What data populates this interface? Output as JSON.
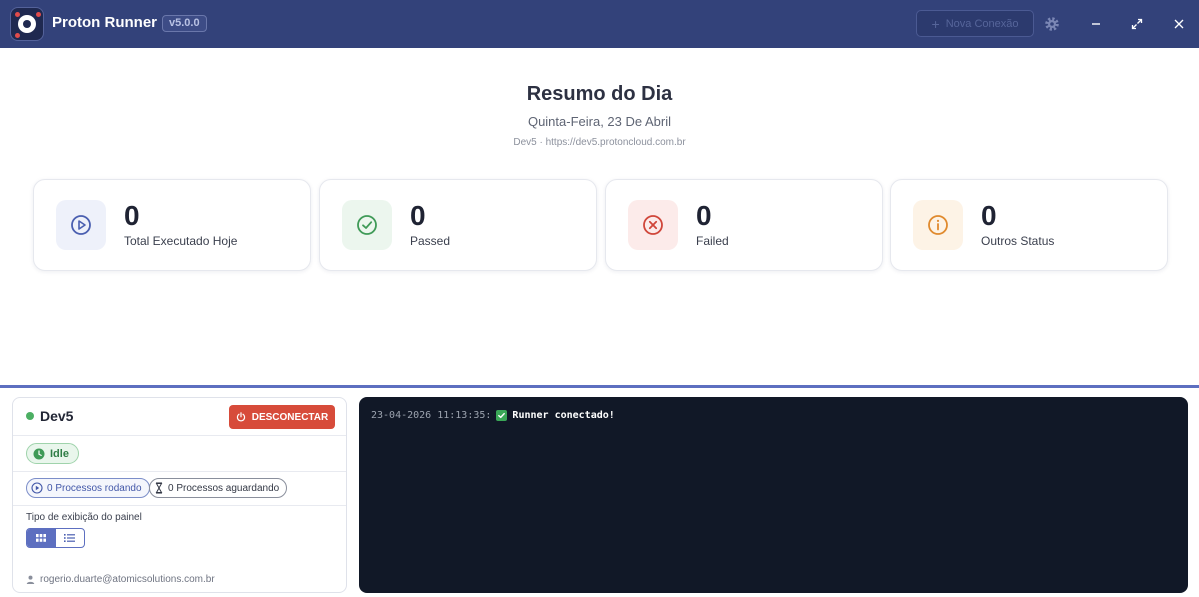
{
  "window": {
    "app_title": "Proton Runner",
    "version": "v5.0.0",
    "new_connection_label": "Nova Conexão",
    "icons": [
      "gear-icon",
      "minimize-icon",
      "maximize-icon",
      "close-icon"
    ]
  },
  "summary": {
    "title": "Resumo do Dia",
    "date": "Quinta-Feira, 23 De Abril",
    "environment": "Dev5 · https://dev5.protoncloud.com.br",
    "cards": [
      {
        "value": "0",
        "label": "Total Executado Hoje",
        "icon": "play-icon",
        "color": "#4a5fb0",
        "bg": "#eef1fa"
      },
      {
        "value": "0",
        "label": "Passed",
        "icon": "check-circle-icon",
        "color": "#3f9a57",
        "bg": "#ecf6ee"
      },
      {
        "value": "0",
        "label": "Failed",
        "icon": "x-circle-icon",
        "color": "#d0463a",
        "bg": "#fcebea"
      },
      {
        "value": "0",
        "label": "Outros Status",
        "icon": "info-icon",
        "color": "#e08a2e",
        "bg": "#fdf3e6"
      }
    ]
  },
  "connection": {
    "name": "Dev5",
    "status_color": "#4caf63",
    "disconnect_label": "DESCONECTAR",
    "state": "Idle",
    "running_label": "0 Processos rodando",
    "waiting_label": "0 Processos aguardando",
    "view_mode_label": "Tipo de exibição do painel",
    "view_modes": [
      "grid-icon",
      "list-icon"
    ],
    "active_view": "grid-icon",
    "user_email": "rogerio.duarte@atomicsolutions.com.br"
  },
  "console": {
    "lines": [
      {
        "time": "23-04-2026 11:13:35:",
        "message": "Runner conectado!"
      }
    ]
  }
}
